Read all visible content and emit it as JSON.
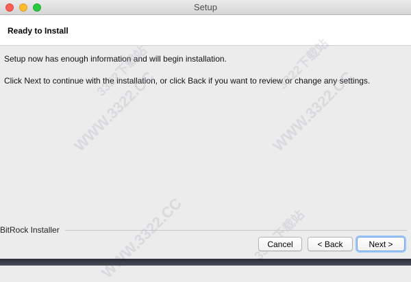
{
  "window": {
    "title": "Setup"
  },
  "header": {
    "title": "Ready to Install"
  },
  "body": {
    "paragraph1": "Setup now has enough information and will begin installation.",
    "paragraph2": "Click Next to continue with the installation, or click Back if you want to review or change any settings."
  },
  "footer": {
    "brand": "BitRock Installer",
    "cancel_label": "Cancel",
    "back_label": "< Back",
    "next_label": "Next >"
  },
  "watermark": {
    "url_text": "WWW.3322.CC",
    "site_text": "3322下载站"
  },
  "colors": {
    "close": "#fc5f57",
    "minimize": "#fdbc2e",
    "maximize": "#28c940",
    "default_button_focus": "#9fc4f6"
  }
}
